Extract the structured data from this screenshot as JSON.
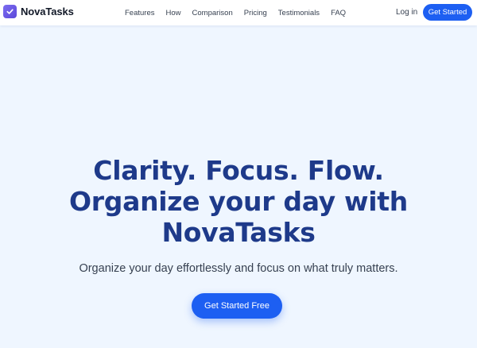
{
  "brand": {
    "name": "NovaTasks",
    "logo_icon": "check-icon",
    "logo_color": "#6c5ce7"
  },
  "nav": {
    "links": [
      "Features",
      "How",
      "Comparison",
      "Pricing",
      "Testimonials",
      "FAQ"
    ],
    "login_label": "Log in",
    "cta_label": "Get Started"
  },
  "hero": {
    "title_line1": "Clarity. Focus. Flow.",
    "title_line2": "Organize your day with",
    "title_line3": "NovaTasks",
    "subtitle": "Organize your day effortlessly and focus on what truly matters.",
    "cta_label": "Get Started Free"
  },
  "colors": {
    "background": "#eff6ff",
    "heading": "#1e3a8a",
    "accent": "#1d5ff2"
  }
}
